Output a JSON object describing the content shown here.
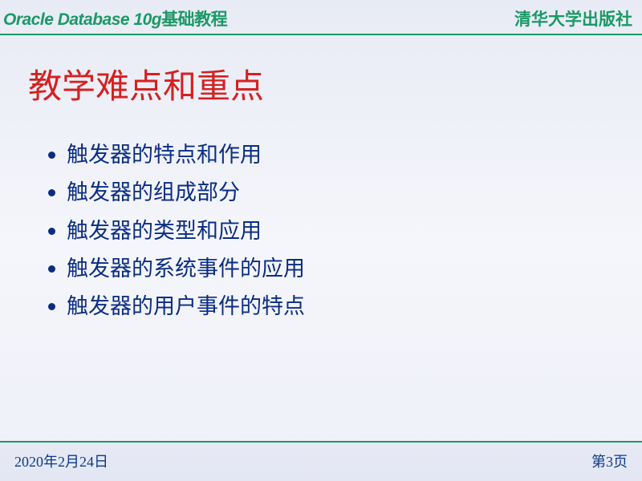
{
  "header": {
    "title_en": "Oracle Database 10g",
    "title_cn": "基础教程",
    "publisher": "清华大学出版社"
  },
  "main": {
    "title": "教学难点和重点",
    "bullets": [
      "触发器的特点和作用",
      "触发器的组成部分",
      "触发器的类型和应用",
      "触发器的系统事件的应用",
      "触发器的用户事件的特点"
    ]
  },
  "footer": {
    "date": "2020年2月24日",
    "page": "第3页"
  }
}
